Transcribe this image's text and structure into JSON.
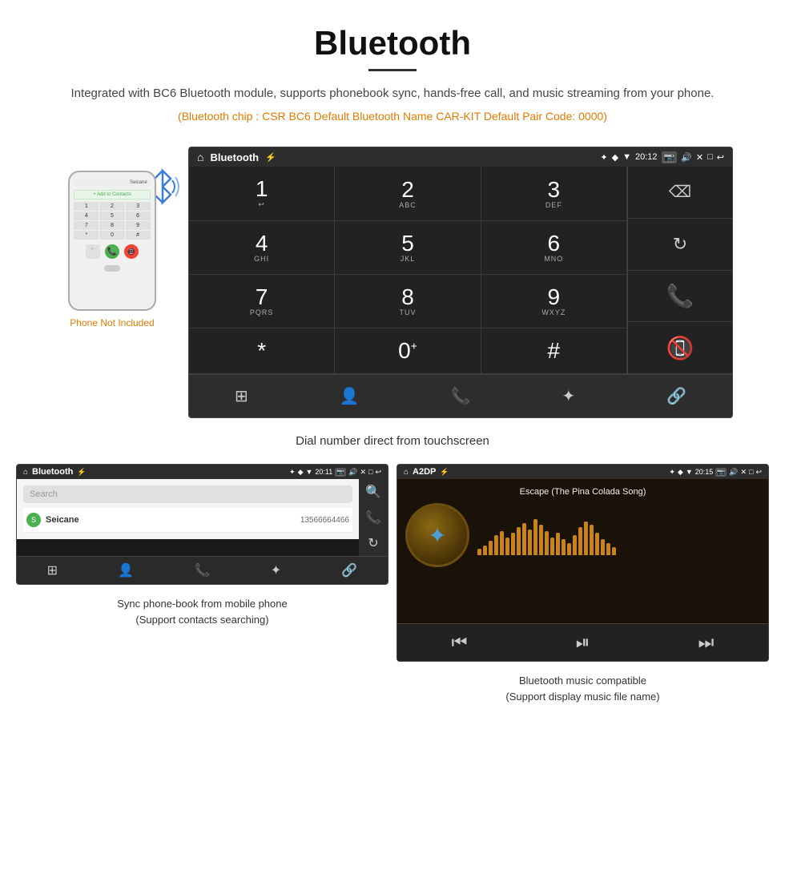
{
  "page": {
    "title": "Bluetooth",
    "description": "Integrated with BC6 Bluetooth module, supports phonebook sync, hands-free call, and music streaming from your phone.",
    "specs": "(Bluetooth chip : CSR BC6    Default Bluetooth Name CAR-KIT    Default Pair Code: 0000)",
    "screen_caption": "Dial number direct from touchscreen",
    "phone_not_included": "Phone Not Included",
    "bottom_caption_left_line1": "Sync phone-book from mobile phone",
    "bottom_caption_left_line2": "(Support contacts searching)",
    "bottom_caption_right_line1": "Bluetooth music compatible",
    "bottom_caption_right_line2": "(Support display music file name)"
  },
  "main_screen": {
    "status_bar": {
      "home_icon": "⌂",
      "app_title": "Bluetooth",
      "usb_icon": "⚡",
      "bt_icon": "✦",
      "location_icon": "◆",
      "signal_icon": "▼",
      "time": "20:12",
      "camera_icon": "📷",
      "volume_icon": "🔊",
      "close_icon": "✕",
      "window_icon": "□",
      "back_icon": "↩"
    },
    "dialpad": {
      "keys": [
        {
          "num": "1",
          "sub": ""
        },
        {
          "num": "2",
          "sub": "ABC"
        },
        {
          "num": "3",
          "sub": "DEF"
        },
        {
          "num": "4",
          "sub": "GHI"
        },
        {
          "num": "5",
          "sub": "JKL"
        },
        {
          "num": "6",
          "sub": "MNO"
        },
        {
          "num": "7",
          "sub": "PQRS"
        },
        {
          "num": "8",
          "sub": "TUV"
        },
        {
          "num": "9",
          "sub": "WXYZ"
        },
        {
          "num": "*",
          "sub": ""
        },
        {
          "num": "0",
          "sub": "+"
        },
        {
          "num": "#",
          "sub": ""
        }
      ]
    },
    "bottom_bar_icons": [
      "⊞",
      "👤",
      "📞",
      "✦",
      "🔗"
    ]
  },
  "phonebook_screen": {
    "app_title": "Bluetooth",
    "time": "20:11",
    "search_placeholder": "Search",
    "contacts": [
      {
        "letter": "S",
        "name": "Seicane",
        "phone": "13566664466"
      }
    ],
    "side_icons": [
      "🔍",
      "📞",
      "↩"
    ],
    "bottom_icons": [
      "⊞",
      "👤",
      "📞",
      "✦",
      "🔗"
    ]
  },
  "music_screen": {
    "app_title": "A2DP",
    "time": "20:15",
    "song_title": "Escape (The Pina Colada Song)",
    "wave_bars": [
      8,
      12,
      18,
      25,
      30,
      22,
      28,
      35,
      40,
      32,
      45,
      38,
      30,
      22,
      28,
      20,
      15,
      25,
      35,
      42,
      38,
      28,
      20,
      15,
      10
    ],
    "controls": [
      "⏮",
      "⏯",
      "⏭"
    ]
  }
}
